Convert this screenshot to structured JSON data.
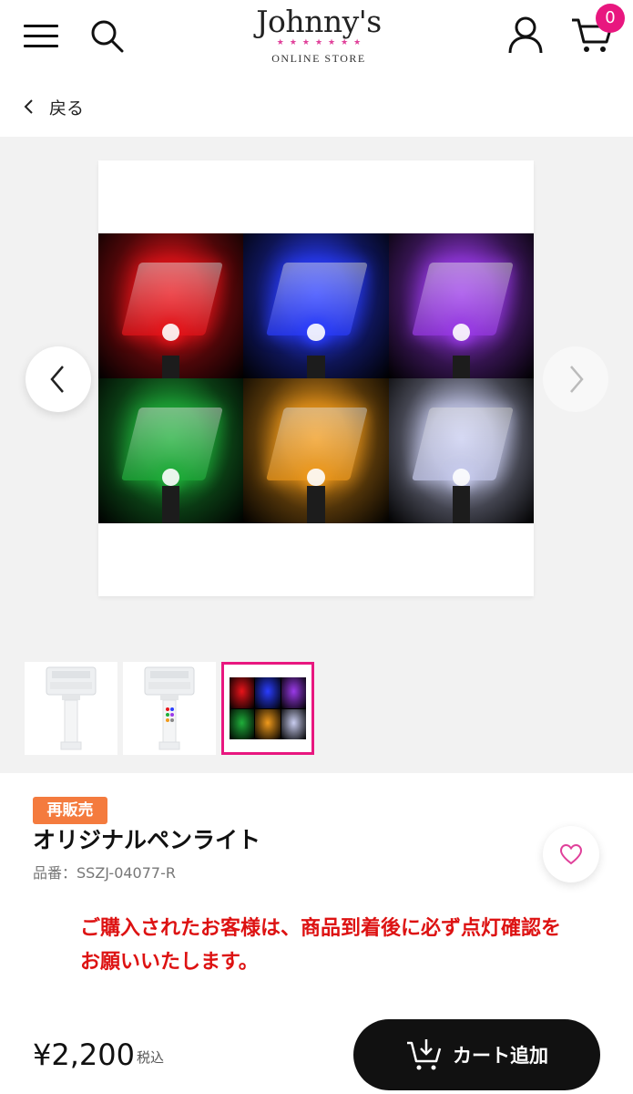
{
  "header": {
    "logo_text": "Johnny's",
    "logo_stars": "★★★★★★★",
    "logo_subtitle": "ONLINE STORE",
    "cart_count": "0",
    "icons": [
      "menu-icon",
      "search-icon",
      "user-icon",
      "cart-icon"
    ]
  },
  "nav": {
    "back_label": "戻る"
  },
  "gallery": {
    "colors": [
      "#e8141a",
      "#2a3dff",
      "#9a3ae8",
      "#1fae3a",
      "#f09a1c",
      "#c9cdf0"
    ],
    "selected_thumbnail": 3,
    "thumbnail_count": 3
  },
  "product": {
    "tag": "再販売",
    "name": "オリジナルペンライト",
    "sku": "品番：SSZJ-04077-R",
    "notice": "ご購入されたお客様は、商品到着後に必ず点灯確認をお願いいたします。",
    "price": "¥2,200",
    "tax_label": "税込",
    "add_to_cart_label": "カート追加"
  },
  "colors": {
    "accent": "#e8177f",
    "tag": "#f47b3e",
    "notice": "#dd1212"
  }
}
